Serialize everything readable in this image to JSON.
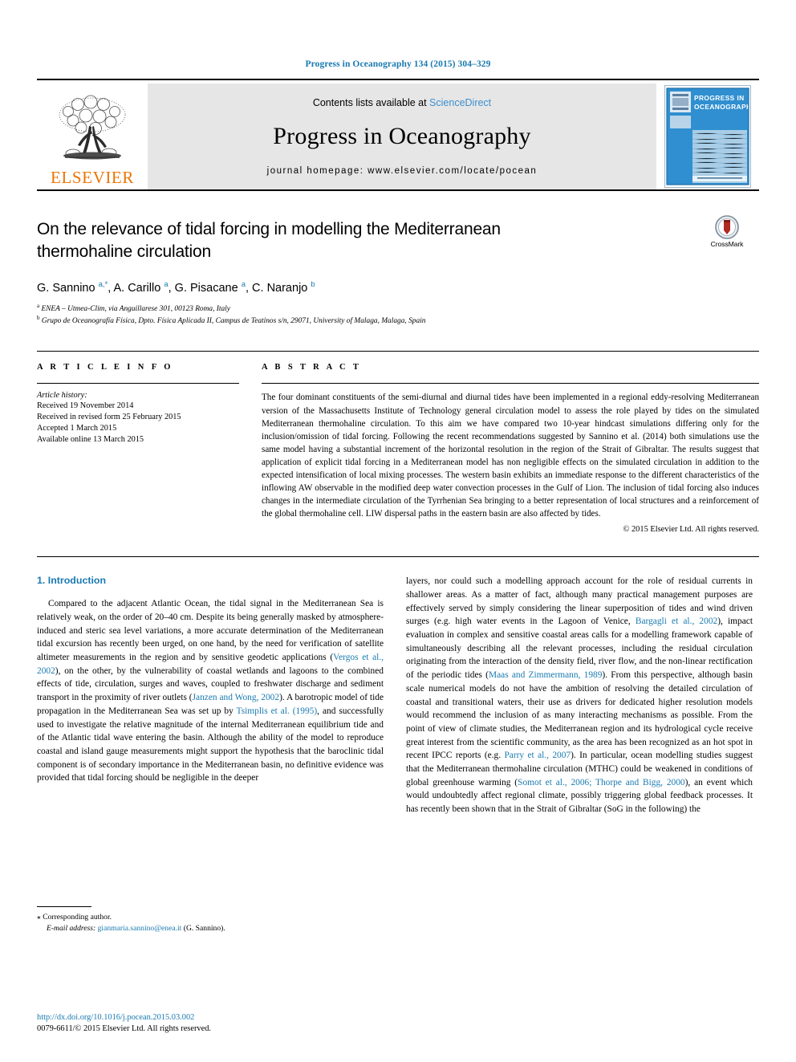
{
  "running_head": "Progress in Oceanography 134 (2015) 304–329",
  "masthead": {
    "contents_prefix": "Contents lists available at ",
    "sciencedirect": "ScienceDirect",
    "journal_title": "Progress in Oceanography",
    "homepage": "journal homepage: www.elsevier.com/locate/pocean",
    "publisher_logo_text": "ELSEVIER",
    "cover_title_line1": "PROGRESS IN",
    "cover_title_line2": "OCEANOGRAPHY"
  },
  "article": {
    "title": "On the relevance of tidal forcing in modelling the Mediterranean thermohaline circulation",
    "authors_html": "G. Sannino <sup>a,*</sup>, A. Carillo <sup>a</sup>, G. Pisacane <sup>a</sup>, C. Naranjo <sup>b</sup>",
    "affiliation_a": "ENEA – Utmea-Clim, via Anguillarese 301, 00123 Roma, Italy",
    "affiliation_b": "Grupo de Oceanografía Física, Dpto. Física Aplicada II, Campus de Teatinos s/n, 29071, University of Malaga, Malaga, Spain",
    "crossmark_label": "CrossMark"
  },
  "article_info": {
    "heading": "A R T I C L E  I N F O",
    "history_label": "Article history:",
    "history": [
      "Received 19 November 2014",
      "Received in revised form 25 February 2015",
      "Accepted 1 March 2015",
      "Available online 13 March 2015"
    ]
  },
  "abstract": {
    "heading": "A B S T R A C T",
    "text": "The four dominant constituents of the semi-diurnal and diurnal tides have been implemented in a regional eddy-resolving Mediterranean version of the Massachusetts Institute of Technology general circulation model to assess the role played by tides on the simulated Mediterranean thermohaline circulation. To this aim we have compared two 10-year hindcast simulations differing only for the inclusion/omission of tidal forcing. Following the recent recommendations suggested by Sannino et al. (2014) both simulations use the same model having a substantial increment of the horizontal resolution in the region of the Strait of Gibraltar. The results suggest that application of explicit tidal forcing in a Mediterranean model has non negligible effects on the simulated circulation in addition to the expected intensification of local mixing processes. The western basin exhibits an immediate response to the different characteristics of the inflowing AW observable in the modified deep water convection processes in the Gulf of Lion. The inclusion of tidal forcing also induces changes in the intermediate circulation of the Tyrrhenian Sea bringing to a better representation of local structures and a reinforcement of the global thermohaline cell. LIW dispersal paths in the eastern basin are also affected by tides.",
    "copyright": "© 2015 Elsevier Ltd. All rights reserved."
  },
  "body": {
    "section_heading": "1. Introduction",
    "left_paragraph_parts": [
      "Compared to the adjacent Atlantic Ocean, the tidal signal in the Mediterranean Sea is relatively weak, on the order of 20–40 cm. Despite its being generally masked by atmosphere-induced and steric sea level variations, a more accurate determination of the Mediterranean tidal excursion has recently been urged, on one hand, by the need for verification of satellite altimeter measurements in the region and by sensitive geodetic applications (",
      "Vergos et al., 2002",
      "), on the other, by the vulnerability of coastal wetlands and lagoons to the combined effects of tide, circulation, surges and waves, coupled to freshwater discharge and sediment transport in the proximity of river outlets (",
      "Janzen and Wong, 2002",
      "). A barotropic model of tide propagation in the Mediterranean Sea was set up by ",
      "Tsimplis et al. (1995)",
      ", and successfully used to investigate the relative magnitude of the internal Mediterranean equilibrium tide and of the Atlantic tidal wave entering the basin. Although the ability of the model to reproduce coastal and island gauge measurements might support the hypothesis that the baroclinic tidal component is of secondary importance in the Mediterranean basin, no definitive evidence was provided that tidal forcing should be negligible in the deeper"
    ],
    "right_paragraph_parts": [
      "layers, nor could such a modelling approach account for the role of residual currents in shallower areas. As a matter of fact, although many practical management purposes are effectively served by simply considering the linear superposition of tides and wind driven surges (e.g. high water events in the Lagoon of Venice, ",
      "Bargagli et al., 2002",
      "), impact evaluation in complex and sensitive coastal areas calls for a modelling framework capable of simultaneously describing all the relevant processes, including the residual circulation originating from the interaction of the density field, river flow, and the non-linear rectification of the periodic tides (",
      "Maas and Zimmermann, 1989",
      "). From this perspective, although basin scale numerical models do not have the ambition of resolving the detailed circulation of coastal and transitional waters, their use as drivers for dedicated higher resolution models would recommend the inclusion of as many interacting mechanisms as possible. From the point of view of climate studies, the Mediterranean region and its hydrological cycle receive great interest from the scientific community, as the area has been recognized as an hot spot in recent IPCC reports (e.g. ",
      "Parry et al., 2007",
      "). In particular, ocean modelling studies suggest that the Mediterranean thermohaline circulation (MTHC) could be weakened in conditions of global greenhouse warming (",
      "Somot et al., 2006; Thorpe and Bigg, 2000",
      "), an event which would undoubtedly affect regional climate, possibly triggering global feedback processes. It has recently been shown that in the Strait of Gibraltar (SoG in the following) the"
    ]
  },
  "footnote": {
    "corresponding_author": "Corresponding author.",
    "email_label": "E-mail address:",
    "email": "gianmaria.sannino@enea.it",
    "email_owner": "(G. Sannino)."
  },
  "footer": {
    "doi": "http://dx.doi.org/10.1016/j.pocean.2015.03.002",
    "issn_line": "0079-6611/© 2015 Elsevier Ltd. All rights reserved."
  },
  "colors": {
    "link_blue": "#1a7ab0",
    "elsevier_orange": "#ec7404",
    "masthead_grey": "#e6e6e6",
    "cover_blue": "#2f8fd0"
  }
}
